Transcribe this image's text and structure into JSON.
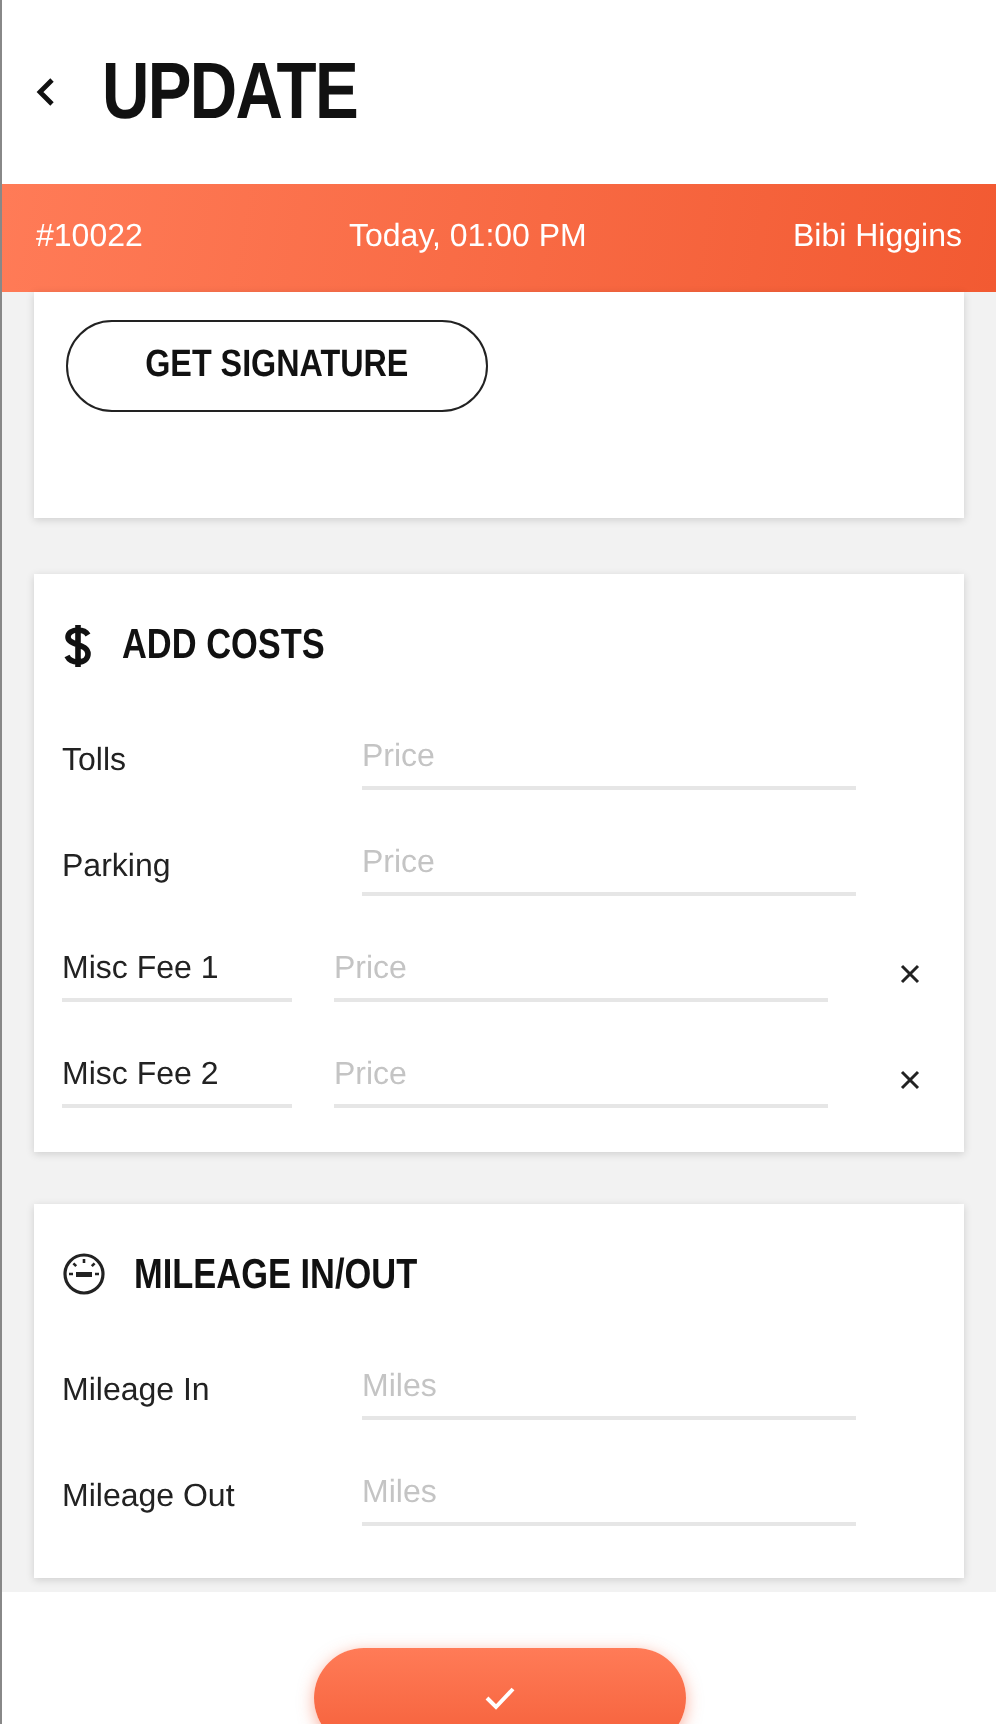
{
  "header": {
    "title": "UPDATE"
  },
  "info_bar": {
    "order": "#10022",
    "time": "Today, 01:00 PM",
    "customer": "Bibi Higgins"
  },
  "signature": {
    "button": "GET SIGNATURE"
  },
  "costs": {
    "title": "ADD COSTS",
    "rows": [
      {
        "kind": "fixed",
        "label": "Tolls",
        "placeholder": "Price"
      },
      {
        "kind": "fixed",
        "label": "Parking",
        "placeholder": "Price"
      },
      {
        "kind": "custom",
        "label": "Misc Fee 1",
        "placeholder": "Price"
      },
      {
        "kind": "custom",
        "label": "Misc Fee 2",
        "placeholder": "Price"
      }
    ]
  },
  "mileage": {
    "title": "MILEAGE IN/OUT",
    "rows": [
      {
        "kind": "fixed",
        "label": "Mileage In",
        "placeholder": "Miles"
      },
      {
        "kind": "fixed",
        "label": "Mileage Out",
        "placeholder": "Miles"
      }
    ]
  }
}
